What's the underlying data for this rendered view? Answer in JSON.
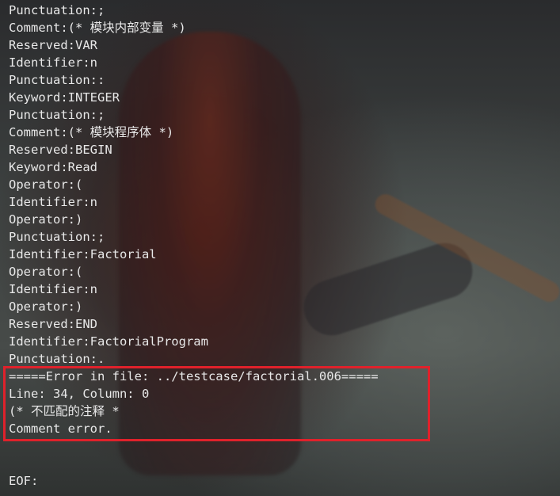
{
  "output_lines": [
    "Punctuation:;",
    "Comment:(* 模块内部变量 *)",
    "Reserved:VAR",
    "Identifier:n",
    "Punctuation::",
    "Keyword:INTEGER",
    "Punctuation:;",
    "Comment:(* 模块程序体 *)",
    "Reserved:BEGIN",
    "Keyword:Read",
    "Operator:(",
    "Identifier:n",
    "Operator:)",
    "Punctuation:;",
    "Identifier:Factorial",
    "Operator:(",
    "Identifier:n",
    "Operator:)",
    "Reserved:END",
    "Identifier:FactorialProgram",
    "Punctuation:."
  ],
  "error": {
    "header": "=====Error in file: ../testcase/factorial.006=====",
    "position": "Line: 34, Column: 0",
    "snippet": "(* 不匹配的注释 *",
    "message": "Comment error."
  },
  "eof_label": "EOF:",
  "colors": {
    "text": "#e8e8e8",
    "highlight_border": "#e0212b"
  }
}
